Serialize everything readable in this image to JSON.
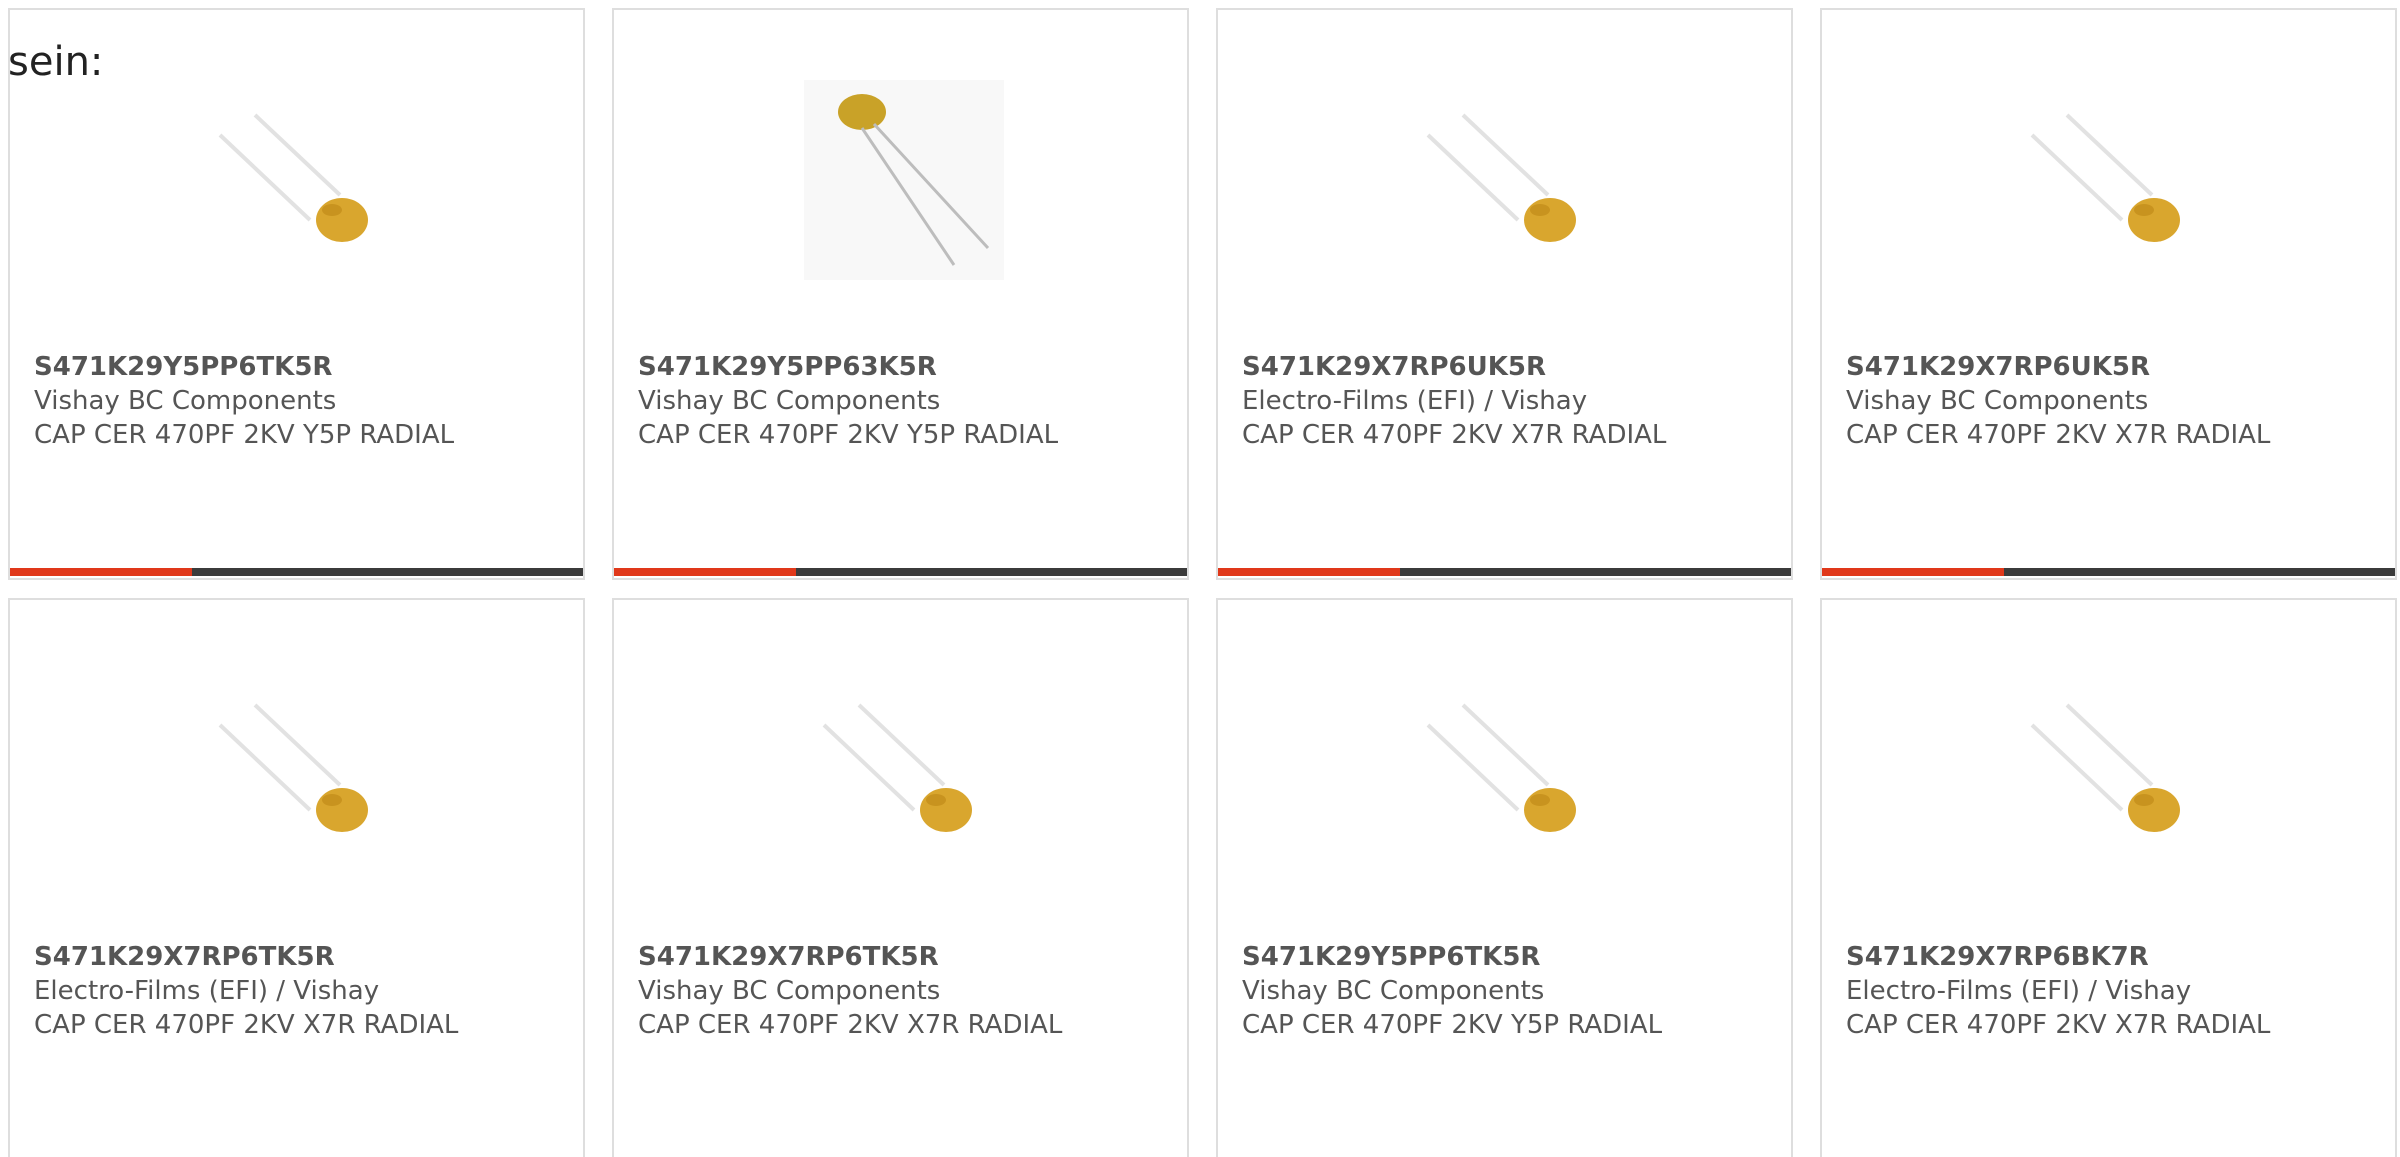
{
  "page": {
    "heading": "sein:"
  },
  "products": [
    {
      "part_number": "S471K29Y5PP6TK5R",
      "manufacturer": "Vishay BC Components",
      "description": "CAP CER 470PF 2KV Y5P RADIAL",
      "image_icon": "radial-disc-capacitor-icon"
    },
    {
      "part_number": "S471K29Y5PP63K5R",
      "manufacturer": "Vishay BC Components",
      "description": "CAP CER 470PF 2KV Y5P RADIAL",
      "image_icon": "radial-disc-capacitor-icon"
    },
    {
      "part_number": "S471K29X7RP6UK5R",
      "manufacturer": "Electro-Films (EFI) / Vishay",
      "description": "CAP CER 470PF 2KV X7R RADIAL",
      "image_icon": "radial-disc-capacitor-icon"
    },
    {
      "part_number": "S471K29X7RP6UK5R",
      "manufacturer": "Vishay BC Components",
      "description": "CAP CER 470PF 2KV X7R RADIAL",
      "image_icon": "radial-disc-capacitor-icon"
    },
    {
      "part_number": "S471K29X7RP6TK5R",
      "manufacturer": "Electro-Films (EFI) / Vishay",
      "description": "CAP CER 470PF 2KV X7R RADIAL",
      "image_icon": "radial-disc-capacitor-icon"
    },
    {
      "part_number": "S471K29X7RP6TK5R",
      "manufacturer": "Vishay BC Components",
      "description": "CAP CER 470PF 2KV X7R RADIAL",
      "image_icon": "radial-disc-capacitor-icon"
    },
    {
      "part_number": "S471K29Y5PP6TK5R",
      "manufacturer": "Vishay BC Components",
      "description": "CAP CER 470PF 2KV Y5P RADIAL",
      "image_icon": "radial-disc-capacitor-icon"
    },
    {
      "part_number": "S471K29X7RP6BK7R",
      "manufacturer": "Electro-Films (EFI) / Vishay",
      "description": "CAP CER 470PF 2KV X7R RADIAL",
      "image_icon": "radial-disc-capacitor-icon"
    }
  ],
  "colors": {
    "accent": "#e0381a",
    "bar": "#3b3b3b",
    "border": "#dedede",
    "text": "#555555",
    "capacitor_body": "#d9a62e"
  }
}
